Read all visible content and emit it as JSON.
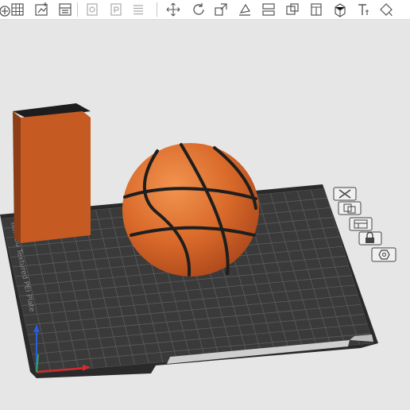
{
  "window": {
    "title": ""
  },
  "toolbar": {
    "left_group": [
      {
        "name": "add-part-icon"
      },
      {
        "name": "arrange-grid-icon"
      },
      {
        "name": "import-model-icon"
      },
      {
        "name": "plate-layout-icon"
      }
    ],
    "middle_group": [
      {
        "name": "copy-plate-icon"
      },
      {
        "name": "plate-settings-icon"
      },
      {
        "name": "object-list-icon"
      }
    ],
    "right_group": [
      {
        "name": "move-icon"
      },
      {
        "name": "rotate-icon"
      },
      {
        "name": "scale-icon"
      },
      {
        "name": "lay-on-face-icon"
      },
      {
        "name": "cut-icon"
      },
      {
        "name": "boolean-icon"
      },
      {
        "name": "support-paint-icon"
      },
      {
        "name": "seam-paint-icon"
      },
      {
        "name": "text-tool-icon"
      },
      {
        "name": "color-paint-icon"
      }
    ]
  },
  "bed": {
    "label": "Bambu Textured PEI Plate",
    "color_bed": "#3a3a3a",
    "color_grid": "#5c5c5c",
    "color_rim": "#262626"
  },
  "plate_toolbar": [
    {
      "name": "delete-plate-icon"
    },
    {
      "name": "auto-orient-icon"
    },
    {
      "name": "arrange-plate-icon"
    },
    {
      "name": "lock-plate-icon"
    },
    {
      "name": "plate-settings-gear-icon"
    }
  ],
  "objects": [
    {
      "name": "box-object",
      "color": "#cc5c24"
    },
    {
      "name": "basketball-object",
      "color": "#d96a2a",
      "seam_color": "#1e1e1e"
    }
  ],
  "axes": {
    "x_color": "#d92a2a",
    "y_color": "#2fa84f",
    "z_color": "#2a5cd9"
  }
}
